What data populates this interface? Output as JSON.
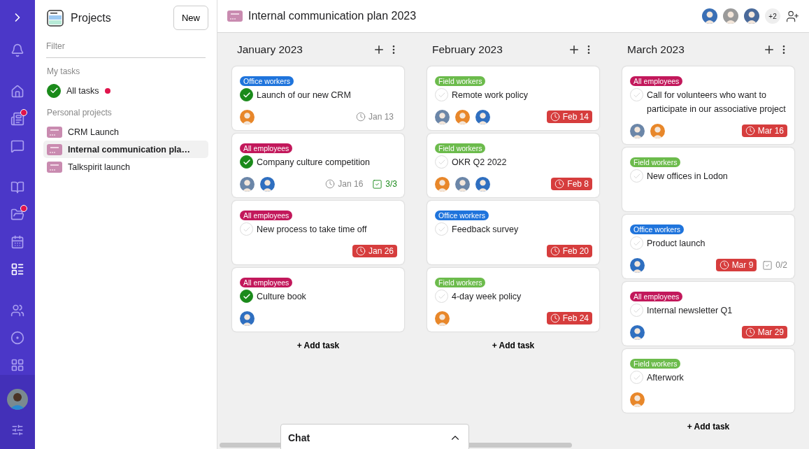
{
  "rail": {
    "items": [
      {
        "badge": false,
        "selected": false
      },
      {
        "badge": false,
        "selected": false
      },
      {
        "badge": true,
        "selected": false
      },
      {
        "badge": false,
        "selected": false
      },
      {
        "badge": false,
        "selected": false
      },
      {
        "badge": true,
        "selected": false
      },
      {
        "badge": false,
        "selected": false
      },
      {
        "badge": false,
        "selected": true
      },
      {
        "badge": false,
        "selected": false
      },
      {
        "badge": false,
        "selected": false
      },
      {
        "badge": false,
        "selected": false
      }
    ]
  },
  "panel": {
    "title": "Projects",
    "new_button": "New",
    "filter_placeholder": "Filter",
    "my_tasks_heading": "My tasks",
    "all_tasks": {
      "label": "All tasks",
      "unread": true
    },
    "personal_heading": "Personal projects",
    "projects": [
      {
        "label": "CRM Launch",
        "selected": false
      },
      {
        "label": "Internal communication pla…",
        "selected": true
      },
      {
        "label": "Talkspirit launch",
        "selected": false
      }
    ]
  },
  "board": {
    "title": "Internal communication plan 2023",
    "members": [
      {
        "color": "#3a6fb5"
      },
      {
        "color": "#9a9a9a"
      },
      {
        "color": "#4a6a9a"
      }
    ],
    "more_members": "+2",
    "columns": [
      {
        "title": "January 2023",
        "add_label": "+ Add task",
        "cards": [
          {
            "tag": {
              "label": "Office workers",
              "color": "#1f74dc"
            },
            "title": "Launch of our new CRM",
            "done": true,
            "assignees": [
              {
                "color": "#e8872a"
              }
            ],
            "due": {
              "text": "Jan 13",
              "overdue": false
            }
          },
          {
            "tag": {
              "label": "All employees",
              "color": "#c2185b"
            },
            "title": "Company culture competition",
            "done": true,
            "assignees": [
              {
                "color": "#6b86a8"
              },
              {
                "color": "#2f6fc0"
              }
            ],
            "due": {
              "text": "Jan 16",
              "overdue": false
            },
            "checklist": {
              "text": "3/3",
              "complete": true
            }
          },
          {
            "tag": {
              "label": "All employees",
              "color": "#c2185b"
            },
            "title": "New process to take time off",
            "done": false,
            "due": {
              "text": "Jan 26",
              "overdue": true
            }
          },
          {
            "tag": {
              "label": "All employees",
              "color": "#c2185b"
            },
            "title": "Culture book",
            "done": true,
            "assignees": [
              {
                "color": "#2f6fc0"
              }
            ]
          }
        ]
      },
      {
        "title": "February 2023",
        "add_label": "+ Add task",
        "cards": [
          {
            "tag": {
              "label": "Field workers",
              "color": "#6cbb4c"
            },
            "title": "Remote work policy",
            "done": false,
            "assignees": [
              {
                "color": "#6b86a8"
              },
              {
                "color": "#e8872a"
              },
              {
                "color": "#2f6fc0"
              }
            ],
            "due": {
              "text": "Feb 14",
              "overdue": true
            }
          },
          {
            "tag": {
              "label": "Field workers",
              "color": "#6cbb4c"
            },
            "title": "OKR Q2 2022",
            "done": false,
            "assignees": [
              {
                "color": "#e8872a"
              },
              {
                "color": "#6b86a8"
              },
              {
                "color": "#2f6fc0"
              }
            ],
            "due": {
              "text": "Feb 8",
              "overdue": true
            }
          },
          {
            "tag": {
              "label": "Office workers",
              "color": "#1f74dc"
            },
            "title": "Feedback survey",
            "done": false,
            "due": {
              "text": "Feb 20",
              "overdue": true
            }
          },
          {
            "tag": {
              "label": "Field workers",
              "color": "#6cbb4c"
            },
            "title": "4-day week policy",
            "done": false,
            "assignees": [
              {
                "color": "#e8872a"
              }
            ],
            "due": {
              "text": "Feb 24",
              "overdue": true
            }
          }
        ]
      },
      {
        "title": "March 2023",
        "add_label": "+ Add task",
        "cards": [
          {
            "tag": {
              "label": "All employees",
              "color": "#c2185b"
            },
            "title": "Call for volunteers who want to participate in our associative project",
            "done": false,
            "assignees": [
              {
                "color": "#6b86a8"
              },
              {
                "color": "#e8872a"
              }
            ],
            "due": {
              "text": "Mar 16",
              "overdue": true
            }
          },
          {
            "tag": {
              "label": "Field workers",
              "color": "#6cbb4c"
            },
            "title": "New offices in Lodon",
            "done": false
          },
          {
            "tag": {
              "label": "Office workers",
              "color": "#1f74dc"
            },
            "title": "Product launch",
            "done": false,
            "assignees": [
              {
                "color": "#2f6fc0"
              }
            ],
            "due": {
              "text": "Mar 9",
              "overdue": true
            },
            "checklist": {
              "text": "0/2",
              "complete": false
            }
          },
          {
            "tag": {
              "label": "All employees",
              "color": "#c2185b"
            },
            "title": "Internal newsletter Q1",
            "done": false,
            "assignees": [
              {
                "color": "#2f6fc0"
              }
            ],
            "due": {
              "text": "Mar 29",
              "overdue": true
            }
          },
          {
            "tag": {
              "label": "Field workers",
              "color": "#6cbb4c"
            },
            "title": "Afterwork",
            "done": false,
            "assignees": [
              {
                "color": "#e8872a"
              }
            ]
          }
        ]
      }
    ]
  },
  "chat": {
    "title": "Chat"
  }
}
